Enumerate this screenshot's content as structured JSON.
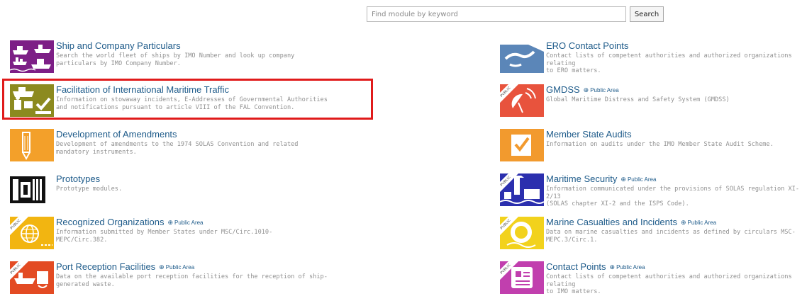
{
  "search": {
    "placeholder": "Find module by keyword",
    "button_label": "Search"
  },
  "public_area_label": "Public Area",
  "public_ribbon_label": "PUBLIC",
  "modules_left": [
    {
      "title": "Ship and Company Particulars",
      "public": false,
      "desc_lines": [
        "Search the world fleet of ships by IMO Number and look up company",
        "particulars by IMO Company Number."
      ],
      "icon": "ship-fleet-icon",
      "color": "#7d1f86"
    },
    {
      "title": "Facilitation of International Maritime Traffic",
      "public": false,
      "desc_lines": [
        "Information on stowaway incidents, E-Addresses of Governmental Authorities",
        "and notifications pursuant to article VIII of the FAL Convention."
      ],
      "icon": "maritime-traffic-icon",
      "color": "#8c8a1f"
    },
    {
      "title": "Development of Amendments",
      "public": false,
      "desc_lines": [
        "Development of amendments to the 1974 SOLAS Convention and related",
        "mandatory instruments."
      ],
      "icon": "pencil-icon",
      "color": "#f3a02a"
    },
    {
      "title": "Prototypes",
      "public": false,
      "desc_lines": [
        "Prototype modules."
      ],
      "icon": "prototype-icon",
      "color": "#111111"
    },
    {
      "title": "Recognized Organizations",
      "public": true,
      "desc_lines": [
        "Information submitted by Member States under MSC/Circ.1010-",
        "MEPC/Circ.382."
      ],
      "icon": "globe-icon",
      "color": "#f2b511"
    },
    {
      "title": "Port Reception Facilities",
      "public": true,
      "desc_lines": [
        "Data on the available port reception facilities for the reception of ship-",
        "generated waste."
      ],
      "icon": "port-facility-icon",
      "color": "#e34b23"
    }
  ],
  "modules_right": [
    {
      "title": "ERO Contact Points",
      "public": false,
      "desc_lines": [
        "Contact lists of competent authorities and authorized organizations relating",
        "to ERO matters."
      ],
      "icon": "handshake-icon",
      "color": "#5b86b8"
    },
    {
      "title": "GMDSS",
      "public": true,
      "desc_lines": [
        "Global Maritime Distress and Safety System (GMDSS)"
      ],
      "icon": "satellite-dish-icon",
      "color": "#e8533d"
    },
    {
      "title": "Member State Audits",
      "public": false,
      "desc_lines": [
        "Information on audits under the IMO Member State Audit Scheme."
      ],
      "icon": "checklist-icon",
      "color": "#f29a2e"
    },
    {
      "title": "Maritime Security",
      "public": true,
      "desc_lines": [
        "Information communicated under the provisions of SOLAS regulation XI-2/13",
        "(SOLAS chapter XI-2 and the ISPS Code)."
      ],
      "icon": "port-security-icon",
      "color": "#2b2fae"
    },
    {
      "title": "Marine Casualties and Incidents",
      "public": true,
      "desc_lines": [
        "Data on marine casualties and incidents as defined by circulars MSC-",
        "MEPC.3/Circ.1."
      ],
      "icon": "lifebuoy-icon",
      "color": "#f2d21c"
    },
    {
      "title": "Contact Points",
      "public": true,
      "desc_lines": [
        "Contact lists of competent authorities and authorized organizations relating",
        "to IMO matters."
      ],
      "icon": "contact-card-icon",
      "color": "#c13fae"
    }
  ]
}
